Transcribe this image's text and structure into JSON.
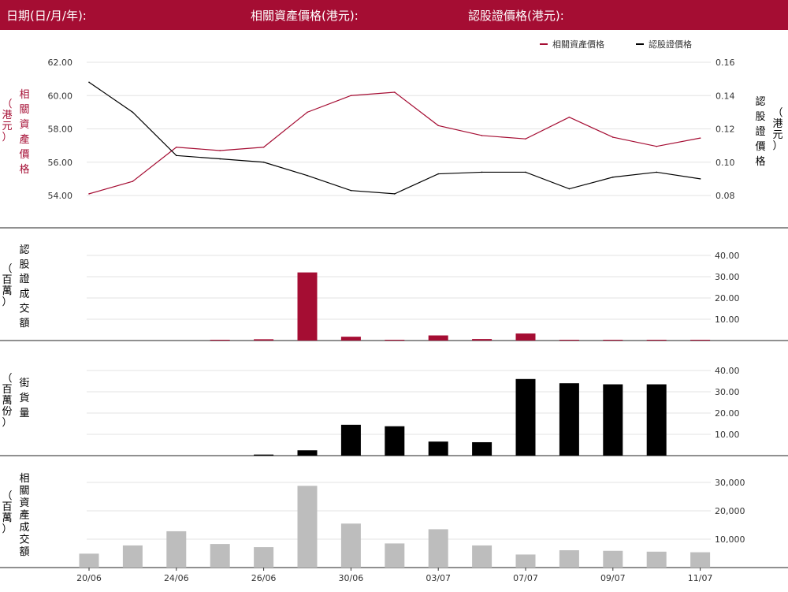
{
  "header": {
    "date_label": "日期(日/月/年):",
    "asset_price_label": "相關資產價格(港元):",
    "warrant_price_label": "認股證價格(港元):",
    "background": "#a50d33"
  },
  "colors": {
    "accent": "#a50d33",
    "black": "#000000",
    "grey": "#bdbdbd",
    "grid": "#e3e3e3"
  },
  "chart_data": [
    {
      "type": "line",
      "x_tick_labels": [
        "20/06",
        "24/06",
        "26/06",
        "30/06",
        "03/07",
        "07/07",
        "09/07",
        "11/07"
      ],
      "series": [
        {
          "name": "相關資產價格",
          "color": "#a50d33",
          "axis": "left",
          "values": [
            54.1,
            54.85,
            56.9,
            56.7,
            56.9,
            59.0,
            60.0,
            60.2,
            58.2,
            57.6,
            57.4,
            58.7,
            57.5,
            56.95,
            57.45
          ]
        },
        {
          "name": "認股證價格",
          "color": "#000000",
          "axis": "right",
          "values": [
            0.148,
            0.13,
            0.104,
            0.102,
            0.1,
            0.092,
            0.083,
            0.081,
            0.093,
            0.094,
            0.094,
            0.084,
            0.091,
            0.094,
            0.09
          ]
        }
      ],
      "left_axis": {
        "label": "相關資產價格（港元）",
        "ticks": [
          "54.00",
          "56.00",
          "58.00",
          "60.00",
          "62.00"
        ],
        "range": [
          53.2,
          62.4
        ]
      },
      "right_axis": {
        "label": "認股證價格（港元）",
        "ticks": [
          "0.08",
          "0.10",
          "0.12",
          "0.14",
          "0.16"
        ],
        "range": [
          0.072,
          0.164
        ]
      },
      "legend": [
        "相關資產價格",
        "認股證價格"
      ],
      "legend_position": "top-right",
      "grid": true
    },
    {
      "type": "bar",
      "label": "認股證成交額（百萬）",
      "color": "#a50d33",
      "ticks": [
        "10.00",
        "20.00",
        "30.00",
        "40.00"
      ],
      "range": [
        0,
        42
      ],
      "values": [
        0,
        0,
        0,
        0.3,
        0.6,
        32,
        1.8,
        0.3,
        2.4,
        0.7,
        3.3,
        0.3,
        0.3,
        0.3,
        0.3
      ]
    },
    {
      "type": "bar",
      "label": "街貨量（百萬份）",
      "color": "#000000",
      "ticks": [
        "10.00",
        "20.00",
        "30.00",
        "40.00"
      ],
      "range": [
        0,
        42
      ],
      "values": [
        0,
        0,
        0,
        0,
        0.5,
        2.5,
        14.5,
        13.8,
        6.6,
        6.3,
        36,
        34,
        33.5,
        33.5,
        0
      ]
    },
    {
      "type": "bar",
      "label": "相關資產成交額（百萬）",
      "color": "#bdbdbd",
      "ticks": [
        "10,000",
        "20,000",
        "30,000"
      ],
      "range": [
        0,
        33000
      ],
      "values": [
        4900,
        7800,
        12800,
        8300,
        7200,
        28800,
        15500,
        8500,
        13500,
        7800,
        4600,
        6100,
        5900,
        5600,
        5400
      ]
    }
  ]
}
